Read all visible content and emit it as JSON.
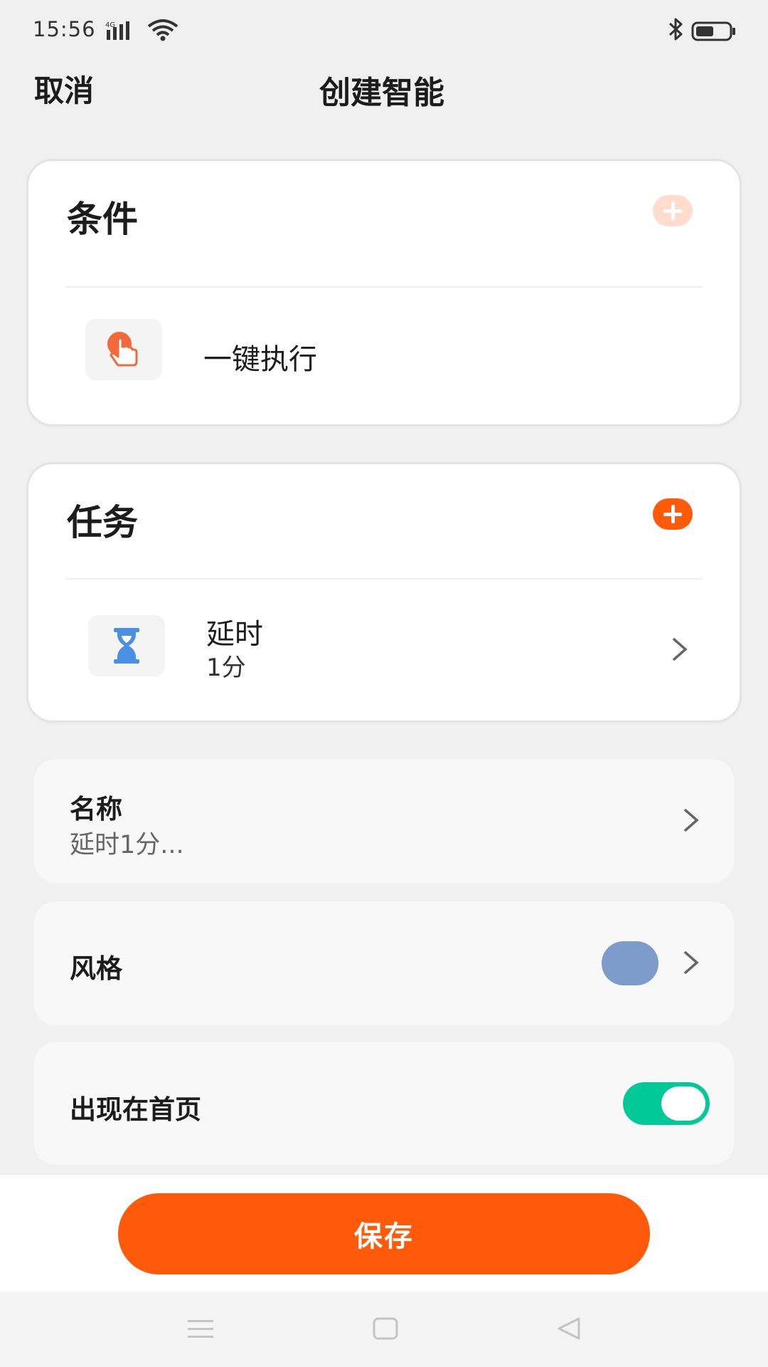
{
  "status": {
    "time": "15:56",
    "network": "4G"
  },
  "header": {
    "cancel_label": "取消",
    "title": "创建智能"
  },
  "conditions": {
    "title": "条件",
    "items": [
      {
        "label": "一键执行",
        "icon": "tap-hand-icon"
      }
    ]
  },
  "tasks": {
    "title": "任务",
    "items": [
      {
        "label": "延时",
        "value": "1分",
        "icon": "hourglass-icon"
      }
    ]
  },
  "settings": {
    "name": {
      "label": "名称",
      "value": "延时1分..."
    },
    "style": {
      "label": "风格",
      "swatch_color": "#7d9cc9"
    },
    "show_on_home": {
      "label": "出现在首页",
      "enabled": true
    }
  },
  "save_label": "保存",
  "colors": {
    "accent": "#ff5a0a",
    "accent_faded": "#ffdccc",
    "toggle_on": "#00c896",
    "hourglass": "#4a90e2"
  },
  "nav": [
    "menu-icon",
    "home-icon",
    "back-icon"
  ]
}
